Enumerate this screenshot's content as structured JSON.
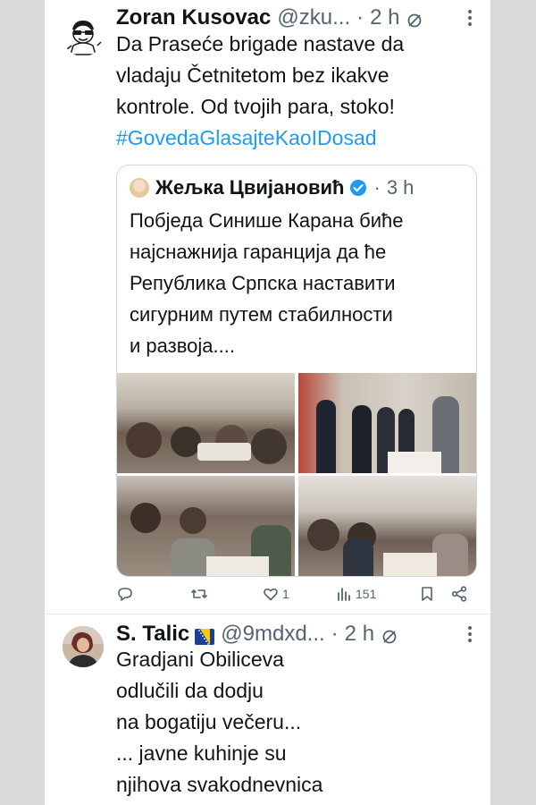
{
  "tweet1": {
    "name": "Zoran Kusovac",
    "handle": "@zku...",
    "dot": "·",
    "time": "2 h",
    "text_lines": [
      "Da Prasеće brigade nastave da",
      "vladaju Četnitetom bez ikakve",
      "kontrole. Od tvojih para, stoko!"
    ],
    "hashtag": "#GovedaGlasajteKaoIDosad",
    "quote": {
      "name": "Жељка Цвијановић",
      "dot": "·",
      "time": "3 h",
      "text_lines": [
        "Побједа Синише Карана биће",
        "најснажнија гаранција да ће",
        "Република Српска наставити",
        "сигурним путем стабилности",
        "и развоја...."
      ]
    },
    "actions": {
      "replies": "",
      "retweets": "",
      "likes": "1",
      "views": "151"
    }
  },
  "tweet2": {
    "name": "S. Talic",
    "handle": "@9mdxd...",
    "dot": "·",
    "time": "2 h",
    "text_lines": [
      "Gradjani Obiliceva",
      "odlučili da dodju",
      "na bogatiju večeru...",
      "... javne kuhinje su",
      "njihova svakodnevnica"
    ]
  },
  "colors": {
    "text": "#0f1419",
    "secondary": "#536471",
    "link": "#1d9bf0",
    "border": "#cfd9de",
    "page_background": "#d9d9d9"
  },
  "icons": [
    "reply-icon",
    "retweet-icon",
    "like-icon",
    "views-icon",
    "bookmark-icon",
    "share-icon",
    "grok-icon",
    "more-icon",
    "verified-icon",
    "bosnia-flag-icon"
  ]
}
